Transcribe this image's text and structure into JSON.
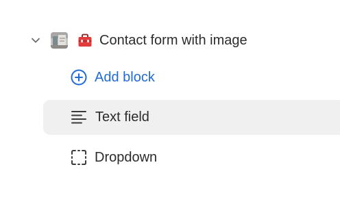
{
  "tree": {
    "parent": {
      "label": "Contact form with image",
      "expanded": true,
      "thumbnail_icon": "image-thumbnail",
      "emoji_icon": "toolbox-icon"
    },
    "add_block": {
      "label": "Add block",
      "icon": "plus-circle-icon",
      "color": "#1f6bd6"
    },
    "items": [
      {
        "label": "Text field",
        "icon": "text-lines-icon",
        "selected": true
      },
      {
        "label": "Dropdown",
        "icon": "dashed-square-icon",
        "selected": false
      }
    ]
  },
  "colors": {
    "text": "#2b2b2b",
    "accent": "#1f6bd6",
    "selected_bg": "#f0f0f0",
    "icon": "#3a3a3a"
  }
}
